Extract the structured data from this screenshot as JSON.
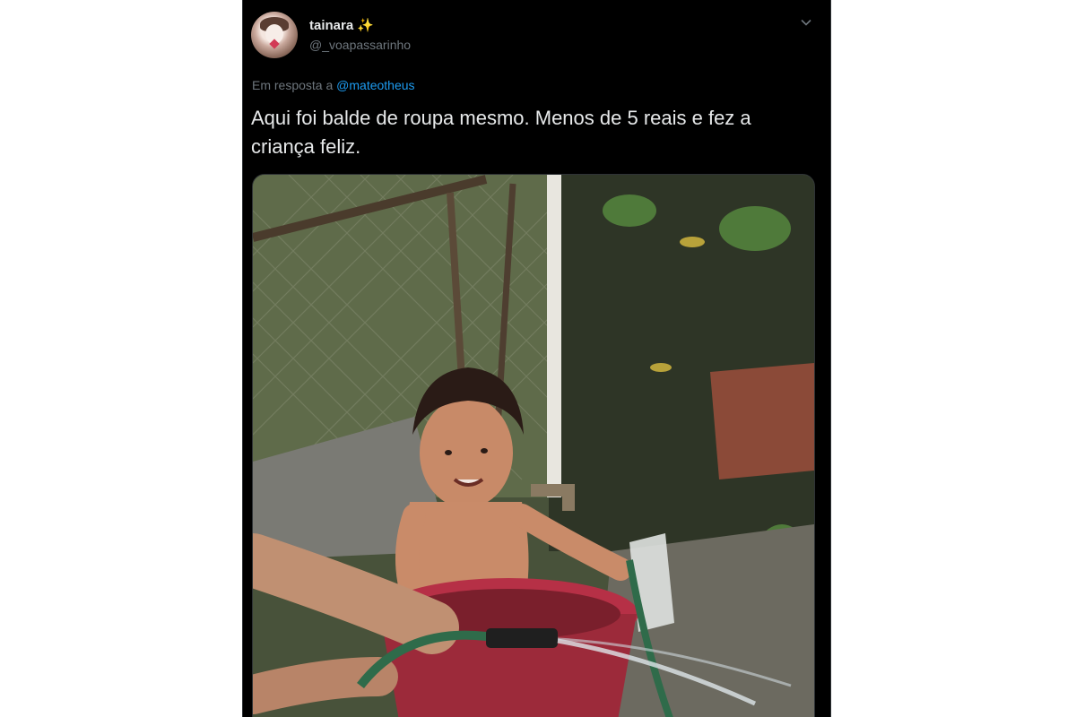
{
  "tweet": {
    "author": {
      "display_name": "tainara",
      "emoji": "✨",
      "handle": "@_voapassarinho",
      "avatar_icon": "profile-avatar"
    },
    "reply": {
      "prefix": "Em resposta a",
      "mention": "@mateotheus"
    },
    "text": "Aqui foi balde de roupa mesmo. Menos de 5 reais e fez a criança feliz.",
    "media": {
      "type": "photo",
      "description_icon": "photo-baby-in-bucket"
    },
    "more_icon": "chevron-down-icon"
  },
  "colors": {
    "background": "#000000",
    "text_primary": "#e7e9ea",
    "text_secondary": "#6e767d",
    "link": "#1d9bf0",
    "bucket": "#9c2a3a",
    "hose": "#2f6b4a"
  }
}
